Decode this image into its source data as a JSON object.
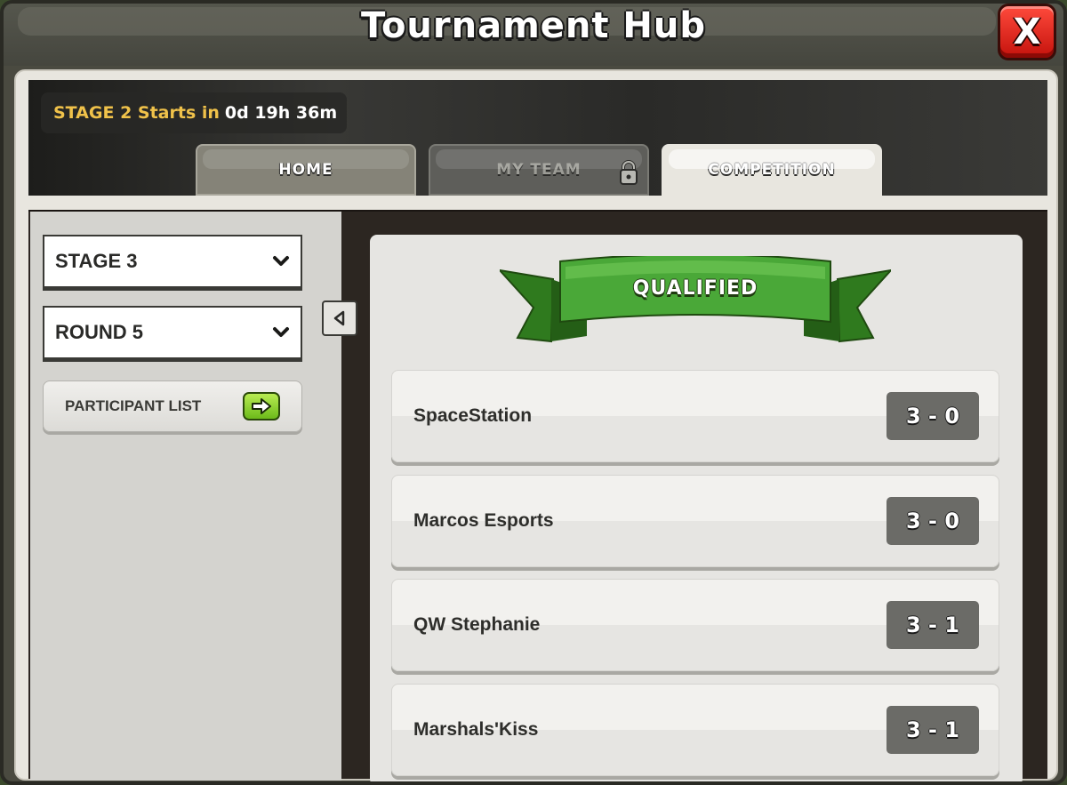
{
  "window": {
    "title": "Tournament Hub",
    "close_label": "X"
  },
  "countdown": {
    "label": "STAGE 2 Starts in",
    "value": "0d 19h 36m"
  },
  "tabs": [
    {
      "label": "HOME",
      "locked": false,
      "active": false
    },
    {
      "label": "MY TEAM",
      "locked": true,
      "active": false
    },
    {
      "label": "COMPETITION",
      "locked": false,
      "active": true
    }
  ],
  "filters": {
    "stage": "STAGE 3",
    "round": "ROUND 5",
    "participant_list_label": "PARTICIPANT LIST"
  },
  "section": {
    "banner": "QUALIFIED"
  },
  "teams": [
    {
      "name": "SpaceStation",
      "score": "3 - 0"
    },
    {
      "name": "Marcos Esports",
      "score": "3 - 0"
    },
    {
      "name": "QW Stephanie",
      "score": "3 - 1"
    },
    {
      "name": "Marshals'Kiss",
      "score": "3 - 1"
    }
  ],
  "icons": {
    "close": "close-icon",
    "lock": "lock-icon",
    "dropdown": "chevron-down-icon",
    "arrow": "arrow-right-icon",
    "collapse": "triangle-left-icon"
  },
  "colors": {
    "countdown_label": "#f0c24a",
    "banner_green": "#3f8f2e",
    "close_red": "#d81e14",
    "arrow_green": "#8fd43a"
  }
}
